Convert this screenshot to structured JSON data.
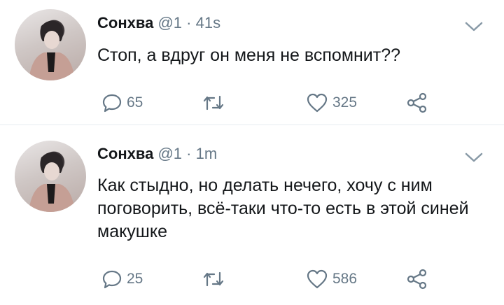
{
  "tweets": [
    {
      "author_name": "Сонхва",
      "handle": "@1",
      "separator": "·",
      "time": "41s",
      "text": "Стоп, а вдруг он меня не вспомнит??",
      "reply_count": "65",
      "like_count": "325"
    },
    {
      "author_name": "Сонхва",
      "handle": "@1",
      "separator": "·",
      "time": "1m",
      "text": "Как стыдно, но делать нечего, хочу с ним поговорить, всё-таки что-то есть в этой синей макушке",
      "reply_count": "25",
      "like_count": "586"
    }
  ],
  "icons": {
    "caret": "chevron-down-icon",
    "reply": "reply-bubble-icon",
    "retweet": "retweet-icon",
    "like": "heart-icon",
    "share": "share-icon"
  },
  "colors": {
    "text": "#14171a",
    "secondary": "#657786",
    "divider": "#e6ecf0"
  }
}
